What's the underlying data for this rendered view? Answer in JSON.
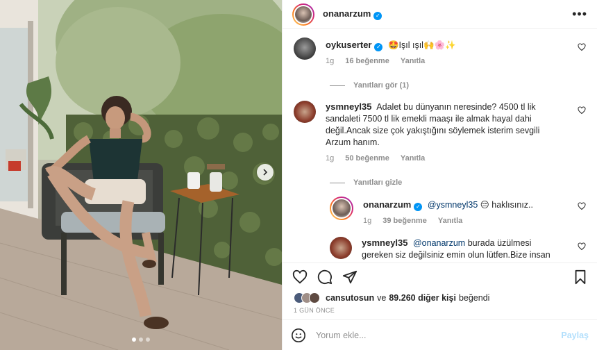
{
  "post": {
    "author": "onanarzum",
    "more_icon": "more-horizontal-icon"
  },
  "comments": [
    {
      "user": "oykuserter",
      "verified": true,
      "text": "🤩Işıl ışıl🙌🌸✨",
      "time": "1g",
      "likes": "16 beğenme",
      "reply": "Yanıtla",
      "replies_toggle": "Yanıtları gör (1)"
    },
    {
      "user": "ysmneyl35",
      "verified": false,
      "text": "Adalet bu dünyanın neresinde? 4500 tl lik sandaleti 7500 tl lik emekli maaşı ile almak hayal dahi değil.Ancak size çok yakıştığını söylemek isterim sevgili Arzum hanım.",
      "time": "1g",
      "likes": "50 beğenme",
      "reply": "Yanıtla",
      "replies_toggle": "Yanıtları gizle"
    }
  ],
  "replies": [
    {
      "user": "onanarzum",
      "verified": true,
      "mention": "@ysmneyl35",
      "text": "😔 haklısınız..",
      "time": "1g",
      "likes": "39 beğenme",
      "reply": "Yanıtla"
    },
    {
      "user": "ysmneyl35",
      "mention": "@onanarzum",
      "text": "burada üzülmesi gereken siz değilsiniz emin olun lütfen.Bize insan gibi yaşamayı"
    }
  ],
  "likes_bar": {
    "first_user": "cansutosun",
    "joiner": "ve",
    "others": "89.260 diğer kişi",
    "suffix": "beğendi"
  },
  "timestamp": "1 GÜN ÖNCE",
  "add_comment": {
    "placeholder": "Yorum ekle...",
    "post_label": "Paylaş"
  },
  "colors": {
    "link": "#00376b",
    "verified": "#0095f6",
    "muted": "#8e8e8e",
    "post_disabled": "#b2dffc"
  }
}
